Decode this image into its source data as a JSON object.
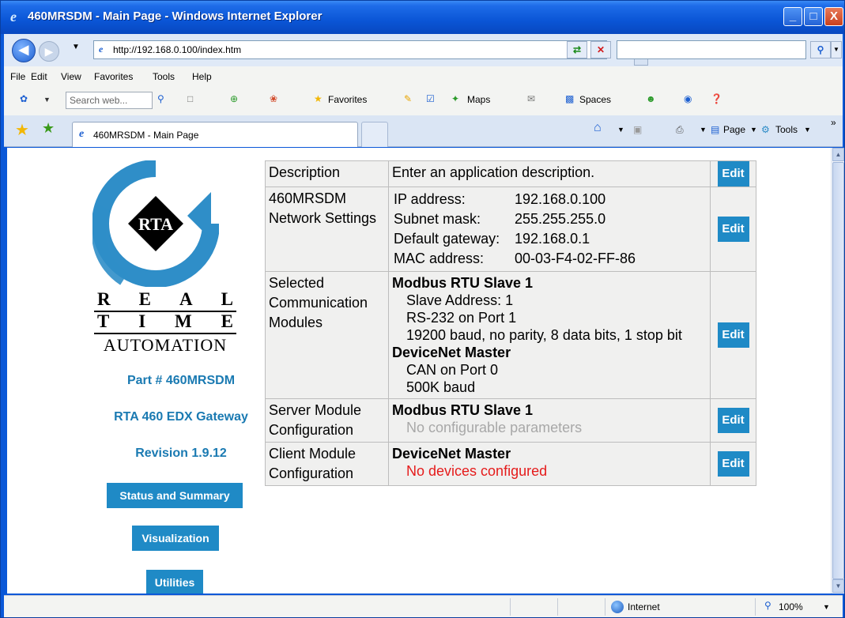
{
  "window": {
    "title": "460MRSDM - Main Page - Windows Internet Explorer",
    "minimize": "_",
    "maximize": "□",
    "close": "X"
  },
  "address": {
    "url": "http://192.168.0.100/index.htm",
    "search_value": ""
  },
  "menu": [
    "File",
    "Edit",
    "View",
    "Favorites",
    "Tools",
    "Help"
  ],
  "toolbar": {
    "search_placeholder": "Search web...",
    "favorites": "Favorites",
    "maps": "Maps",
    "spaces": "Spaces"
  },
  "tab": {
    "title": "460MRSDM - Main Page",
    "page": "Page",
    "tools": "Tools",
    "chevron": "»"
  },
  "sidebar": {
    "brand_row1": [
      "R",
      "E",
      "A",
      "L"
    ],
    "brand_row2": [
      "T",
      "I",
      "M",
      "E"
    ],
    "brand_row3": "AUTOMATION",
    "logo_text": "RTA",
    "part": "Part # 460MRSDM",
    "gateway": "RTA 460 EDX Gateway",
    "revision": "Revision 1.9.12",
    "buttons": [
      "Status and Summary",
      "Visualization",
      "Utilities"
    ]
  },
  "config": {
    "edit_label": "Edit",
    "description": {
      "head": "Description",
      "value": "Enter an application description."
    },
    "network": {
      "head": "460MRSDM Network Settings",
      "rows": [
        {
          "k": "IP address:",
          "v": "192.168.0.100"
        },
        {
          "k": "Subnet mask:",
          "v": "255.255.255.0"
        },
        {
          "k": "Default gateway:",
          "v": "192.168.0.1"
        },
        {
          "k": "MAC address:",
          "v": "00-03-F4-02-FF-86"
        }
      ]
    },
    "modules": {
      "head": "Selected Communication Modules",
      "m1_title": "Modbus RTU Slave 1",
      "m1_lines": [
        "Slave Address: 1",
        "RS-232 on Port 1",
        "19200 baud, no parity, 8 data bits, 1 stop bit"
      ],
      "m2_title": "DeviceNet Master",
      "m2_lines": [
        "CAN on Port 0",
        "500K baud"
      ]
    },
    "server": {
      "head": "Server Module Configuration",
      "title": "Modbus RTU Slave 1",
      "note": "No configurable parameters"
    },
    "client": {
      "head": "Client Module Configuration",
      "title": "DeviceNet Master",
      "note": "No devices configured"
    }
  },
  "status": {
    "zone": "Internet",
    "zoom": "100%"
  },
  "colors": {
    "accent": "#1f8ac6",
    "error": "#e51b1b",
    "muted": "#a8a8a8"
  }
}
